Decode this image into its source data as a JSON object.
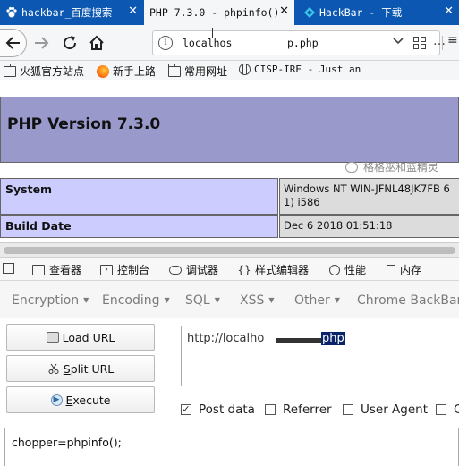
{
  "tabs": [
    {
      "title": "hackbar_百度搜索",
      "active": false,
      "icon": "baidu-paw-icon"
    },
    {
      "title": "PHP 7.3.0 - phpinfo()",
      "active": true,
      "icon": "blank-page-icon"
    },
    {
      "title": "HackBar - 下载",
      "active": false,
      "icon": "hackbar-icon"
    }
  ],
  "tab_close_glyph": "✕",
  "address": {
    "url_start": "localhos",
    "url_end": "p.php"
  },
  "bookmarks": [
    {
      "label": "火狐官方站点",
      "icon": "folder-icon"
    },
    {
      "label": "新手上路",
      "icon": "firefox-icon"
    },
    {
      "label": "常用网址",
      "icon": "folder-icon"
    },
    {
      "label": "CISP-IRE - Just an",
      "icon": "globe-icon"
    }
  ],
  "phpinfo": {
    "heading": "PHP Version 7.3.0",
    "rows": [
      {
        "key": "System",
        "value_line1": "Windows NT WIN-JFNL48JK7FB 6",
        "value_line2": "1) i586"
      },
      {
        "key": "Build Date",
        "value_line1": "Dec 6 2018 01:51:18"
      }
    ]
  },
  "devtools": {
    "tabs": [
      "查看器",
      "控制台",
      "调试器",
      "样式编辑器",
      "性能",
      "内存"
    ]
  },
  "hackbar": {
    "menu": [
      {
        "label": "Encryption",
        "dropdown": true
      },
      {
        "label": "Encoding",
        "dropdown": true
      },
      {
        "label": "SQL",
        "dropdown": true
      },
      {
        "label": "XSS",
        "dropdown": true
      },
      {
        "label": "Other",
        "dropdown": true
      },
      {
        "label": "Chrome BackBar",
        "dropdown": false
      }
    ],
    "buttons": {
      "load": {
        "prefix": "L",
        "suffix": "oad URL"
      },
      "split": {
        "prefix": "S",
        "suffix": "plit URL"
      },
      "execute": {
        "prefix": "E",
        "suffix": "xecute"
      }
    },
    "url_value_start": "http://localho",
    "url_value_selected": "php",
    "checkboxes": [
      {
        "label": "Post data",
        "checked": true
      },
      {
        "label": "Referrer",
        "checked": false
      },
      {
        "label": "User Agent",
        "checked": false
      },
      {
        "label": "C",
        "checked": false
      }
    ],
    "post_data": "chopper=phpinfo();"
  },
  "watermark": "格格巫和蓝精灵"
}
